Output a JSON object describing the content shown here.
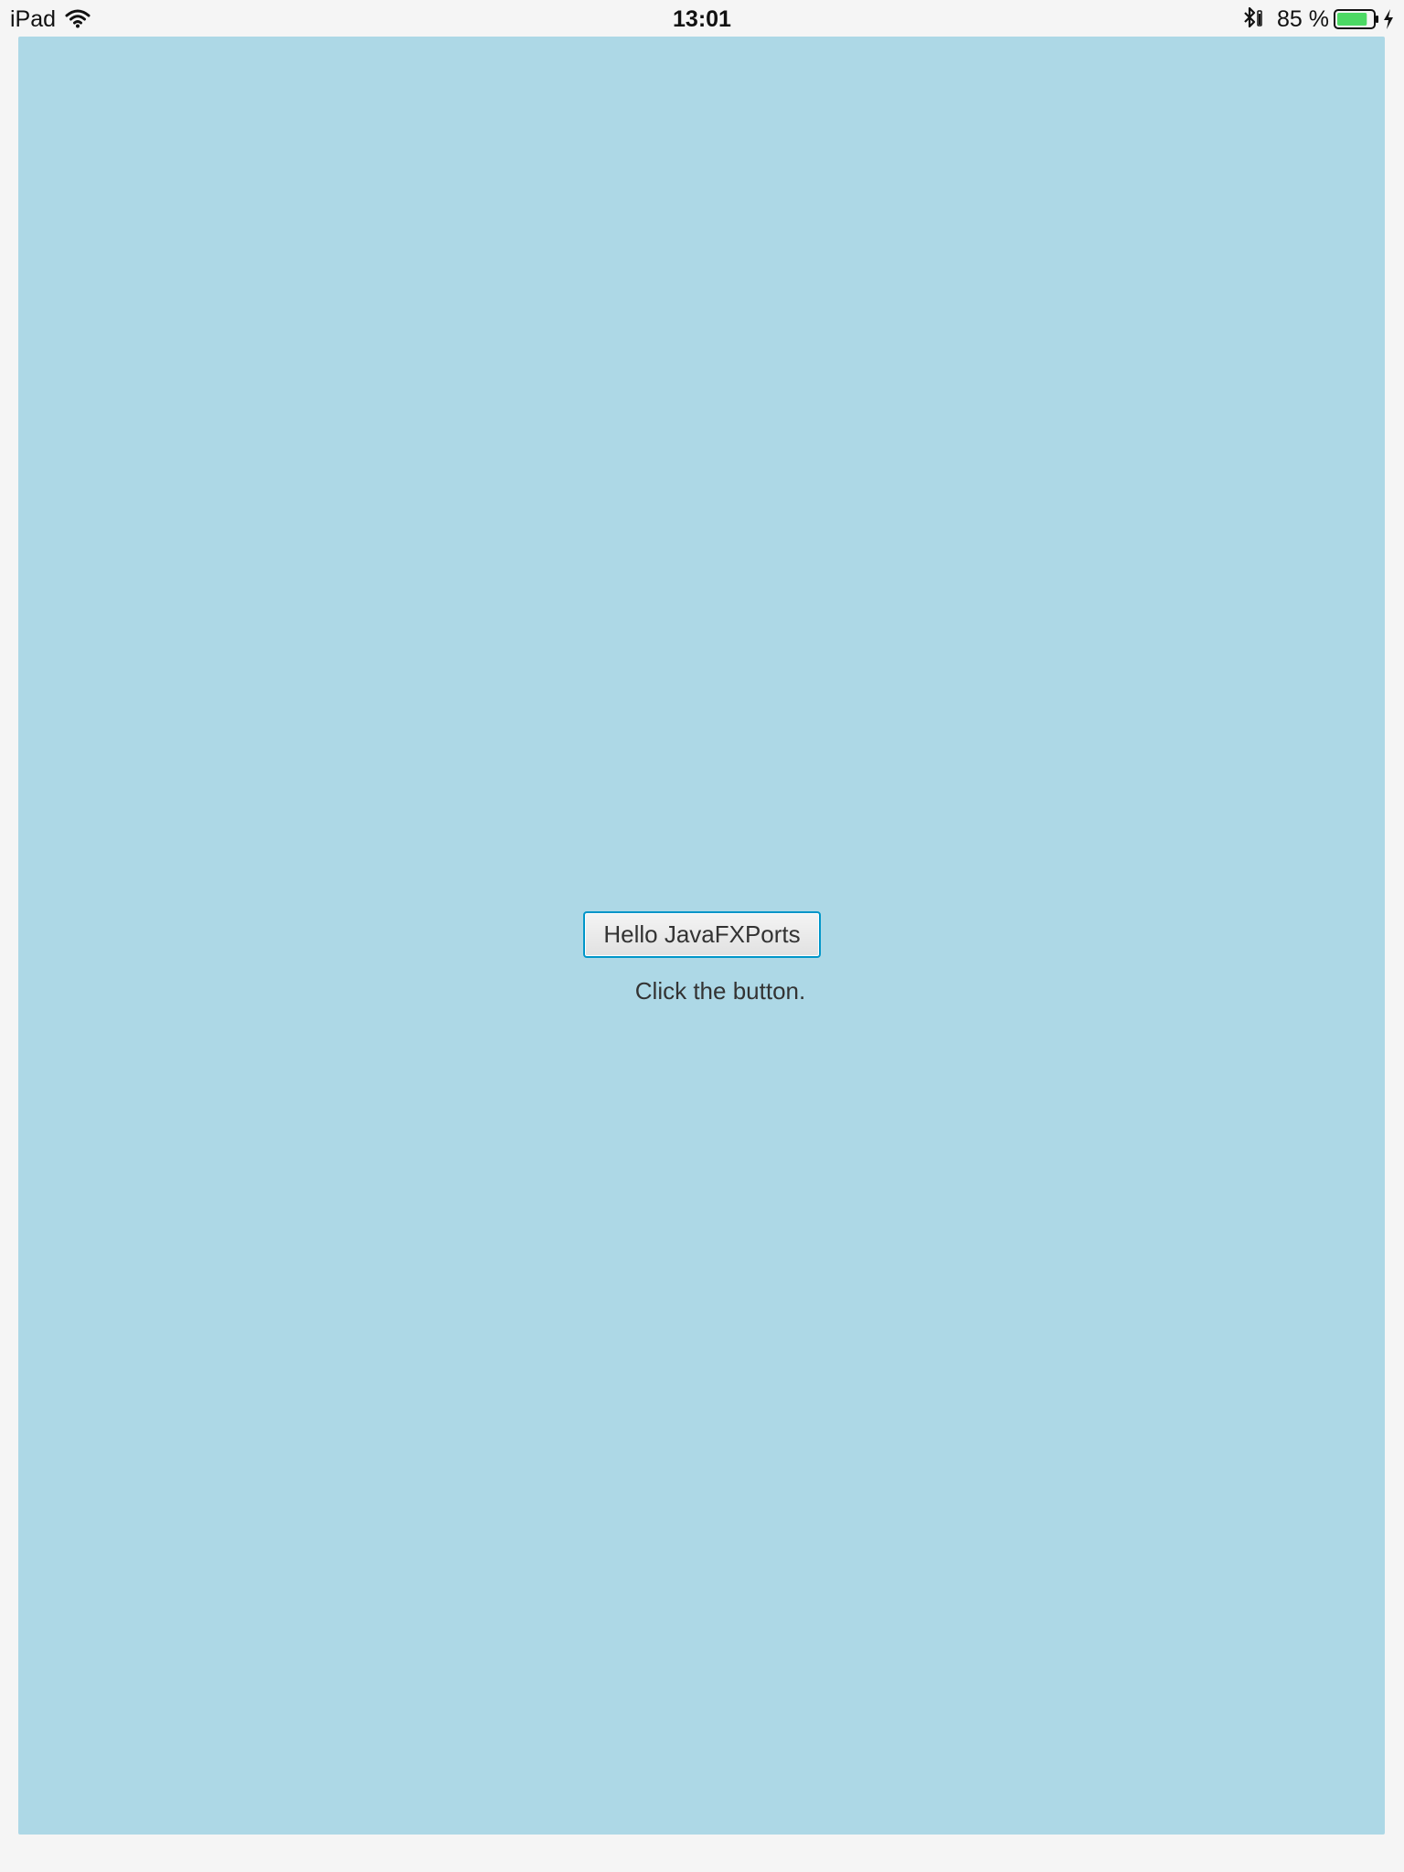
{
  "status_bar": {
    "device": "iPad",
    "time": "13:01",
    "battery_percent": "85 %",
    "battery_level": 0.85,
    "icons": [
      "wifi-icon",
      "bluetooth-icon",
      "battery-icon",
      "charging-icon"
    ],
    "battery_color": "#4cd964"
  },
  "app": {
    "background_color": "#add8e6",
    "button_label": "Hello JavaFXPorts",
    "status_text": "Click the button."
  }
}
